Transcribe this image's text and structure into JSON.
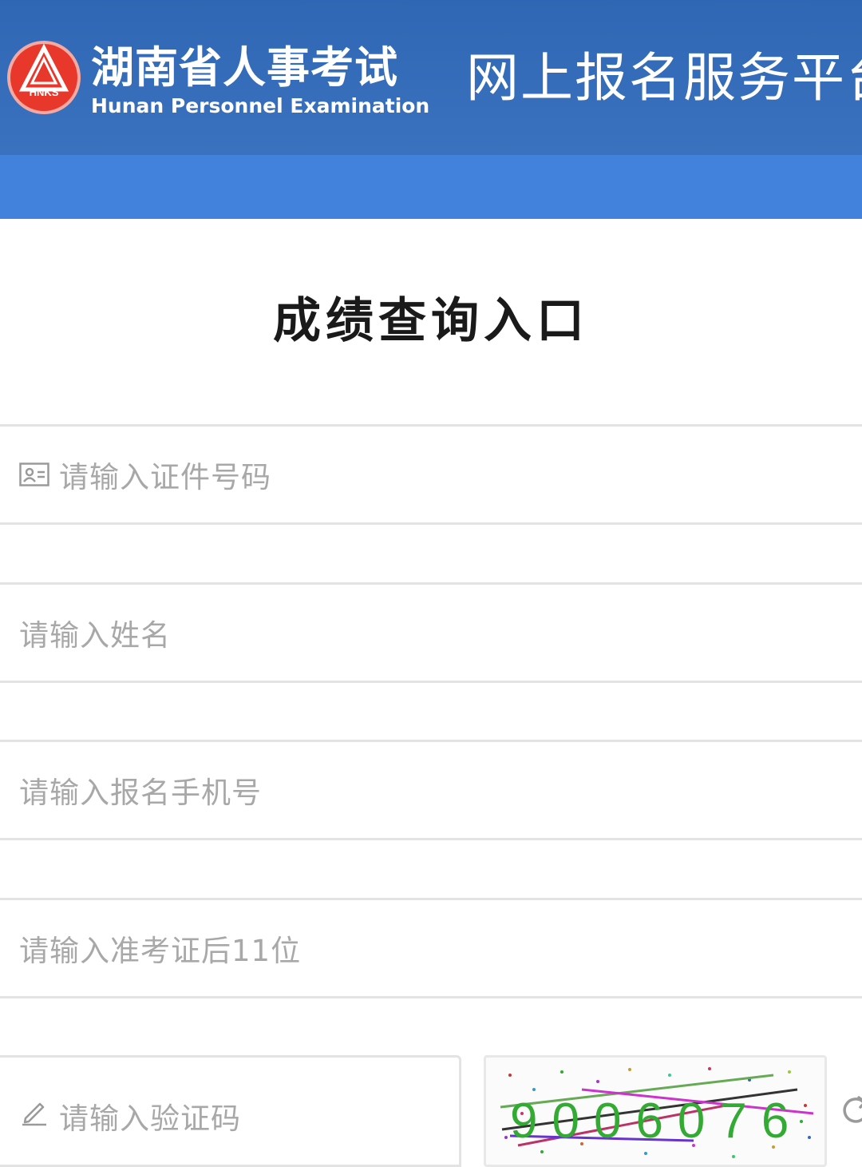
{
  "header": {
    "logo_text": "HNKS",
    "brand_cn": "湖南省人事考试",
    "brand_en": "Hunan Personnel Examination",
    "platform_title": "网上报名服务平台"
  },
  "page": {
    "title": "成绩查询入口"
  },
  "form": {
    "id_number_placeholder": "请输入证件号码",
    "name_placeholder": "请输入姓名",
    "phone_placeholder": "请输入报名手机号",
    "ticket_placeholder": "请输入准考证后11位",
    "captcha_placeholder": "请输入验证码",
    "captcha_code": "9006076"
  },
  "colors": {
    "header_bg": "#2f67b4",
    "navbar_bg": "#4282dc",
    "logo_red": "#e8382c",
    "placeholder": "#a8a8a8",
    "border": "#e3e3e3"
  },
  "icons": {
    "id_field": "id-card-icon",
    "captcha_field": "pencil-icon",
    "refresh": "refresh-icon"
  }
}
